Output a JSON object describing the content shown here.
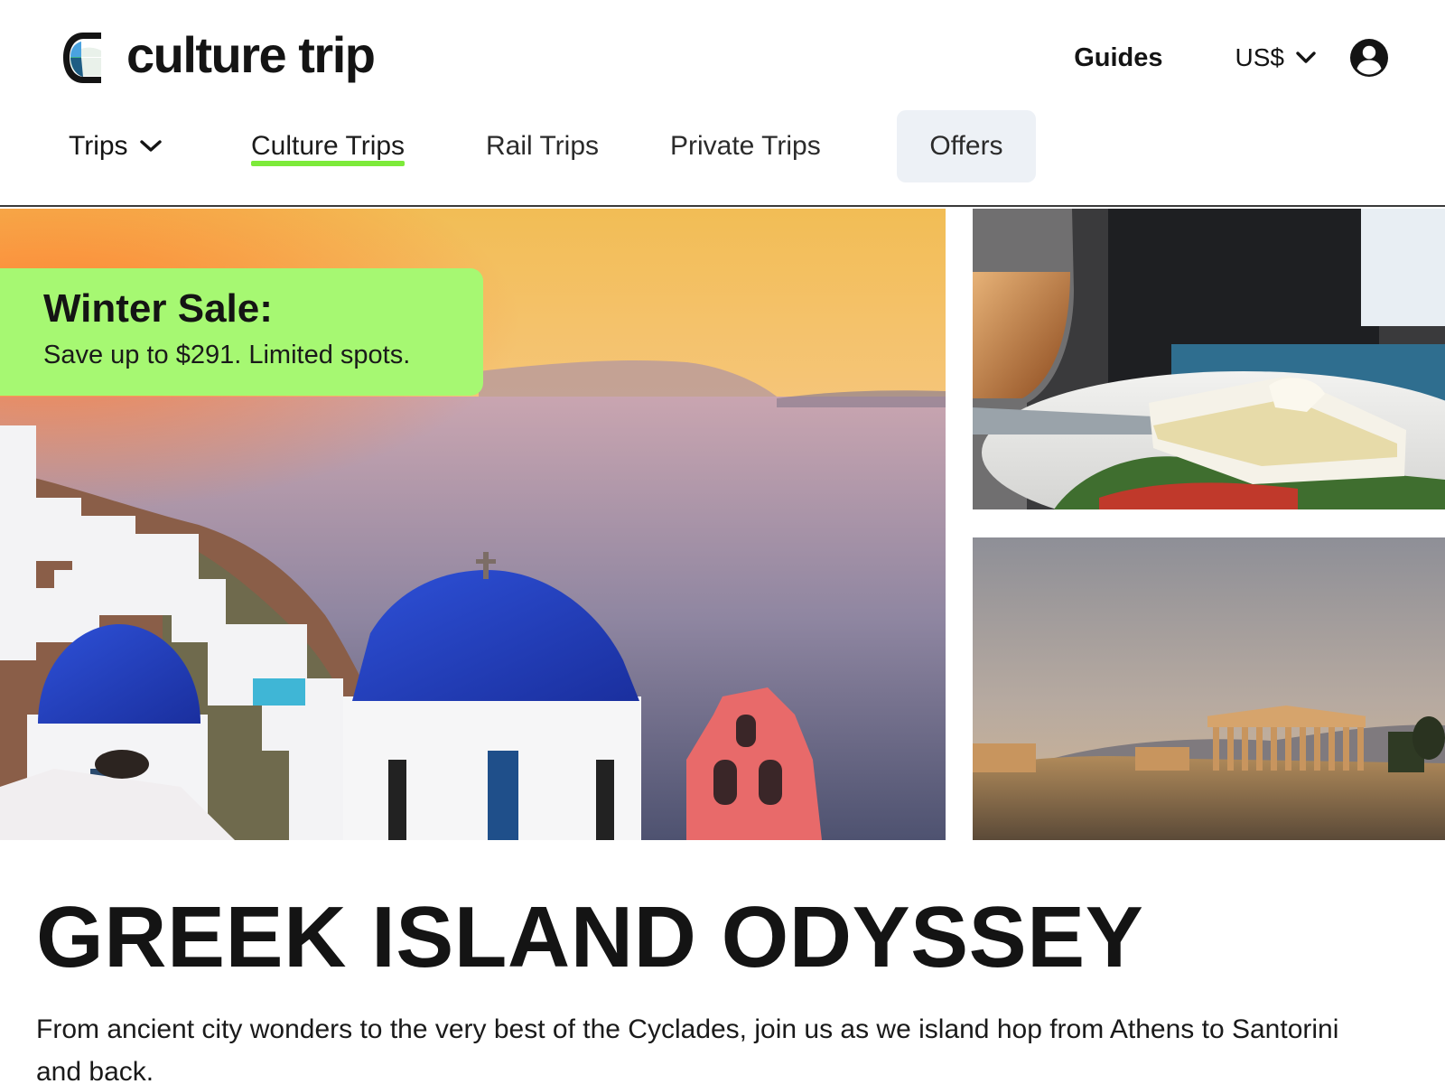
{
  "brand": {
    "name": "culture trip",
    "accent": "#7dea3a",
    "banner_color": "#a6f872"
  },
  "header": {
    "guides_label": "Guides",
    "currency_label": "US$",
    "account_icon": "user-circle-icon"
  },
  "nav": {
    "trips_label": "Trips",
    "items": [
      {
        "label": "Culture Trips",
        "active": true
      },
      {
        "label": "Rail Trips",
        "active": false
      },
      {
        "label": "Private Trips",
        "active": false
      },
      {
        "label": "Offers",
        "active": false
      }
    ]
  },
  "promo": {
    "title": "Winter Sale:",
    "subtitle": "Save up to $291. Limited spots."
  },
  "gallery": {
    "main_image": "santorini-blue-domes-sunset",
    "side_images": [
      "greek-salad-feta-wine",
      "acropolis-athens-sunset"
    ]
  },
  "trip": {
    "title": "GREEK ISLAND ODYSSEY",
    "description": "From ancient city wonders to the very best of the Cyclades, join us as we island hop from Athens to Santorini and back."
  }
}
